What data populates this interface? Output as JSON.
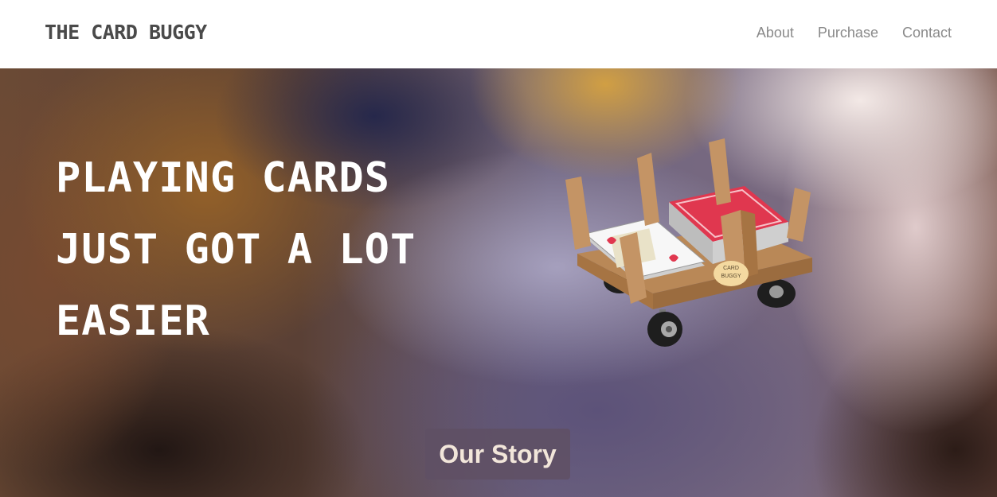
{
  "navbar": {
    "brand": "THE CARD BUGGY",
    "links": [
      {
        "label": "About"
      },
      {
        "label": "Purchase"
      },
      {
        "label": "Contact"
      }
    ]
  },
  "hero": {
    "headline_lines": [
      "PLAYING CARDS",
      "JUST GOT A LOT",
      "EASIER"
    ],
    "product_label_line1": "CARD",
    "product_label_line2": "BUGGY",
    "cta_label": "Our Story"
  },
  "colors": {
    "nav_background": "#ffffff",
    "brand_text": "#4a4a4a",
    "nav_link_text": "#8a8a8a",
    "headline_text": "#ffffff",
    "cta_background": "#5f5064",
    "cta_text": "#f2e6da",
    "buggy_tan": "#c49465",
    "card_red": "#e0374f"
  }
}
